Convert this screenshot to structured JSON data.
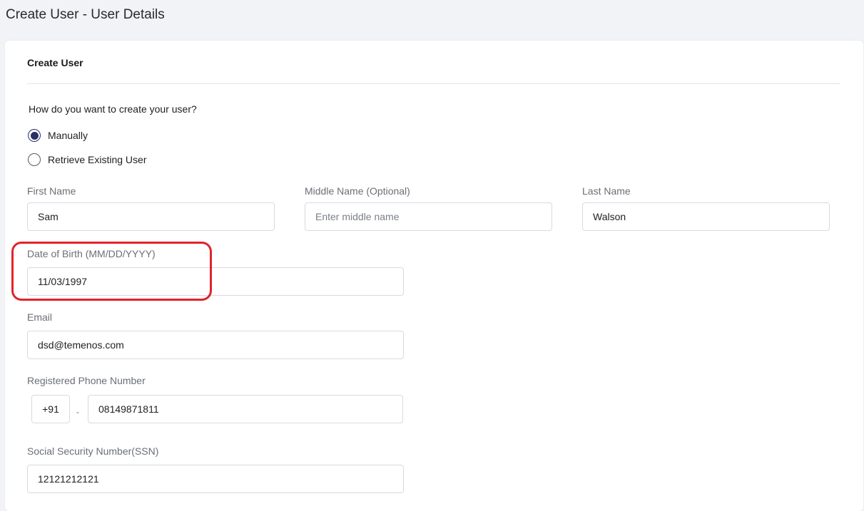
{
  "page": {
    "title": "Create User - User Details"
  },
  "card": {
    "heading": "Create User"
  },
  "creation_method": {
    "question": "How do you want to create your user?",
    "options": [
      {
        "label": "Manually",
        "selected": true
      },
      {
        "label": "Retrieve Existing User",
        "selected": false
      }
    ]
  },
  "fields": {
    "first_name": {
      "label": "First Name",
      "value": "Sam"
    },
    "middle_name": {
      "label": "Middle Name (Optional)",
      "value": "",
      "placeholder": "Enter middle name"
    },
    "last_name": {
      "label": "Last Name",
      "value": "Walson"
    },
    "dob": {
      "label": "Date of Birth (MM/DD/YYYY)",
      "value": "11/03/1997"
    },
    "email": {
      "label": "Email",
      "value": "dsd@temenos.com"
    },
    "phone": {
      "label": "Registered Phone Number",
      "country_code": "+91",
      "separator": "-",
      "value": "08149871811"
    },
    "ssn": {
      "label": "Social Security Number(SSN)",
      "value": "12121212121"
    }
  },
  "colors": {
    "accent": "#2b2f66",
    "highlight": "#e0242b",
    "background": "#f1f3f6"
  }
}
